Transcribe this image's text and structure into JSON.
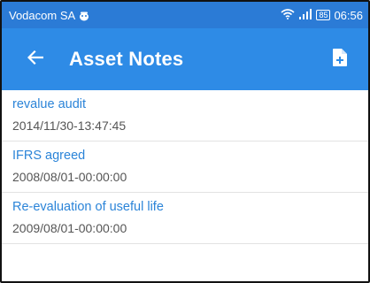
{
  "status_bar": {
    "carrier": "Vodacom SA",
    "carrier_icon": "sync-icon",
    "battery_level": "85",
    "time": "06:56"
  },
  "app_bar": {
    "title": "Asset Notes",
    "back_icon": "arrow-left-icon",
    "action_icon": "add-file-icon"
  },
  "notes": [
    {
      "title": "revalue audit",
      "date": "2014/11/30-13:47:45"
    },
    {
      "title": "IFRS agreed",
      "date": "2008/08/01-00:00:00"
    },
    {
      "title": "Re-evaluation of useful life",
      "date": "2009/08/01-00:00:00"
    }
  ],
  "colors": {
    "status_bar": "#2b7bd6",
    "app_bar": "#2e8be6",
    "note_title": "#2b84d8",
    "note_date": "#555555"
  }
}
